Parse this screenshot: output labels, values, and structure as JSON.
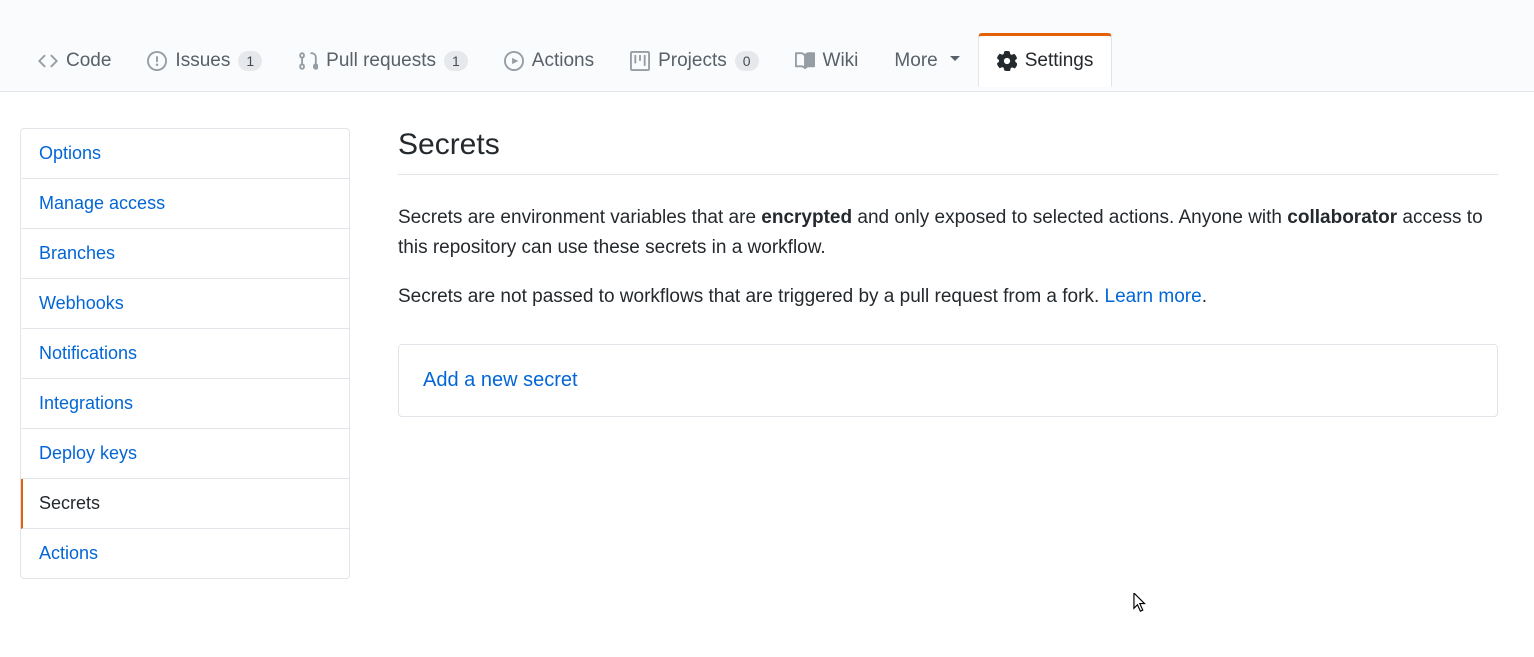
{
  "tabs": {
    "code": "Code",
    "issues": "Issues",
    "issues_count": "1",
    "pulls": "Pull requests",
    "pulls_count": "1",
    "actions": "Actions",
    "projects": "Projects",
    "projects_count": "0",
    "wiki": "Wiki",
    "more": "More",
    "settings": "Settings"
  },
  "sidebar": {
    "items": [
      "Options",
      "Manage access",
      "Branches",
      "Webhooks",
      "Notifications",
      "Integrations",
      "Deploy keys",
      "Secrets",
      "Actions"
    ],
    "active_index": 7
  },
  "main": {
    "title": "Secrets",
    "para1_a": "Secrets are environment variables that are ",
    "para1_b": "encrypted",
    "para1_c": " and only exposed to selected actions. Anyone with ",
    "para1_d": "collaborator",
    "para1_e": " access to this repository can use these secrets in a workflow.",
    "para2_a": "Secrets are not passed to workflows that are triggered by a pull request from a fork. ",
    "para2_link": "Learn more",
    "para2_b": ".",
    "add_secret": "Add a new secret"
  }
}
